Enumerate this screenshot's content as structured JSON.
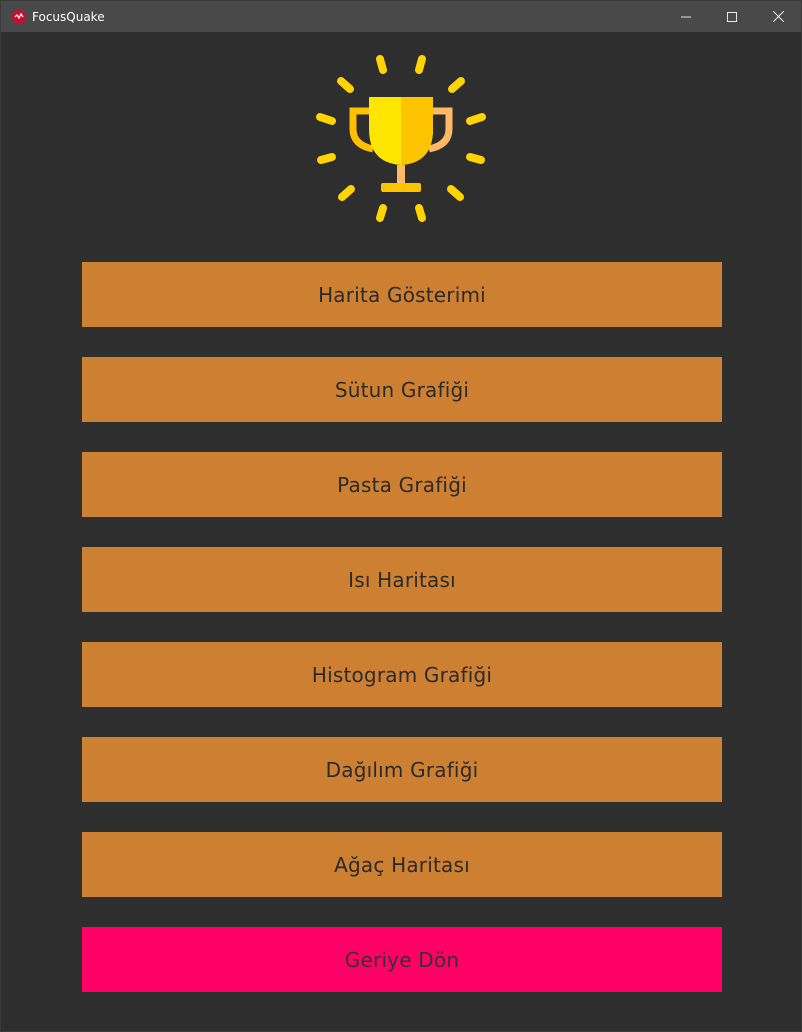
{
  "window": {
    "title": "FocusQuake",
    "controls": [
      "minimize-icon",
      "maximize-icon",
      "close-icon"
    ]
  },
  "logo": {
    "icon": "trophy-icon"
  },
  "menu": {
    "buttons": [
      {
        "label": "Harita Gösterimi"
      },
      {
        "label": "Sütun Grafiği"
      },
      {
        "label": "Pasta Grafiği"
      },
      {
        "label": "Isı Haritası"
      },
      {
        "label": "Histogram Grafiği"
      },
      {
        "label": "Dağılım Grafiği"
      },
      {
        "label": "Ağaç Haritası"
      }
    ],
    "back_label": "Geriye Dön"
  },
  "colors": {
    "background": "#2e2e2e",
    "button": "#cd7f32",
    "back_button": "#ff0066",
    "trophy_gold": "#ffd400"
  }
}
